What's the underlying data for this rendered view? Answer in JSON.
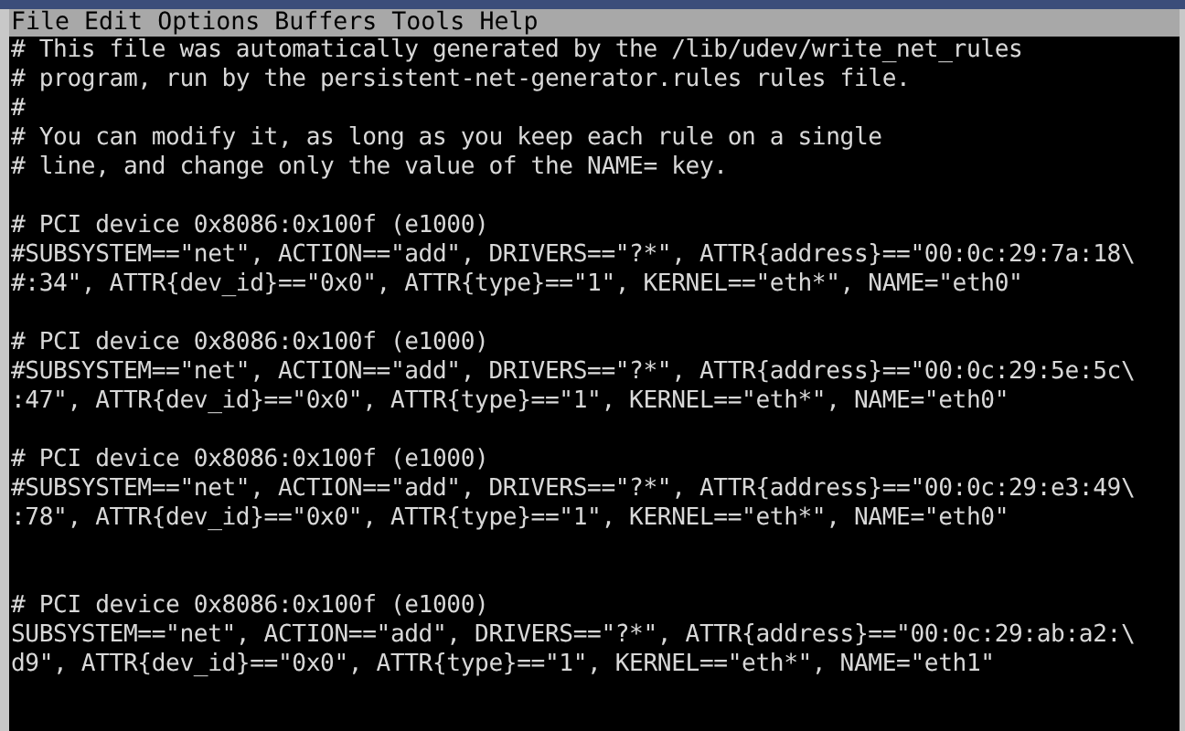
{
  "menu_bar": [
    "File",
    "Edit",
    "Options",
    "Buffers",
    "Tools",
    "Help"
  ],
  "buffer_lines": [
    {
      "kind": "text",
      "text": "# This file was automatically generated by the /lib/udev/write_net_rules"
    },
    {
      "kind": "text",
      "text": "# program, run by the persistent-net-generator.rules rules file."
    },
    {
      "kind": "text",
      "text": "#"
    },
    {
      "kind": "text",
      "text": "# You can modify it, as long as you keep each rule on a single"
    },
    {
      "kind": "text",
      "text": "# line, and change only the value of the NAME= key."
    },
    {
      "kind": "blank"
    },
    {
      "kind": "text",
      "text": "# PCI device 0x8086:0x100f (e1000)"
    },
    {
      "kind": "text",
      "text": "#SUBSYSTEM==\"net\", ACTION==\"add\", DRIVERS==\"?*\", ATTR{address}==\"00:0c:29:7a:18\\"
    },
    {
      "kind": "text",
      "text": "#:34\", ATTR{dev_id}==\"0x0\", ATTR{type}==\"1\", KERNEL==\"eth*\", NAME=\"eth0\""
    },
    {
      "kind": "blank"
    },
    {
      "kind": "text",
      "text": "# PCI device 0x8086:0x100f (e1000)"
    },
    {
      "kind": "text",
      "text": "#SUBSYSTEM==\"net\", ACTION==\"add\", DRIVERS==\"?*\", ATTR{address}==\"00:0c:29:5e:5c\\"
    },
    {
      "kind": "text",
      "text": ":47\", ATTR{dev_id}==\"0x0\", ATTR{type}==\"1\", KERNEL==\"eth*\", NAME=\"eth0\""
    },
    {
      "kind": "blank"
    },
    {
      "kind": "text",
      "text": "# PCI device 0x8086:0x100f (e1000)"
    },
    {
      "kind": "text",
      "text": "#SUBSYSTEM==\"net\", ACTION==\"add\", DRIVERS==\"?*\", ATTR{address}==\"00:0c:29:e3:49\\"
    },
    {
      "kind": "text",
      "text": ":78\", ATTR{dev_id}==\"0x0\", ATTR{type}==\"1\", KERNEL==\"eth*\", NAME=\"eth0\""
    },
    {
      "kind": "blank"
    },
    {
      "kind": "blank"
    },
    {
      "kind": "text",
      "text": "# PCI device 0x8086:0x100f (e1000)"
    },
    {
      "kind": "text",
      "text": "SUBSYSTEM==\"net\", ACTION==\"add\", DRIVERS==\"?*\", ATTR{address}==\"00:0c:29:ab:a2:\\"
    },
    {
      "kind": "text",
      "text": "d9\", ATTR{dev_id}==\"0x0\", ATTR{type}==\"1\", KERNEL==\"eth*\", NAME=\"eth1\""
    }
  ]
}
